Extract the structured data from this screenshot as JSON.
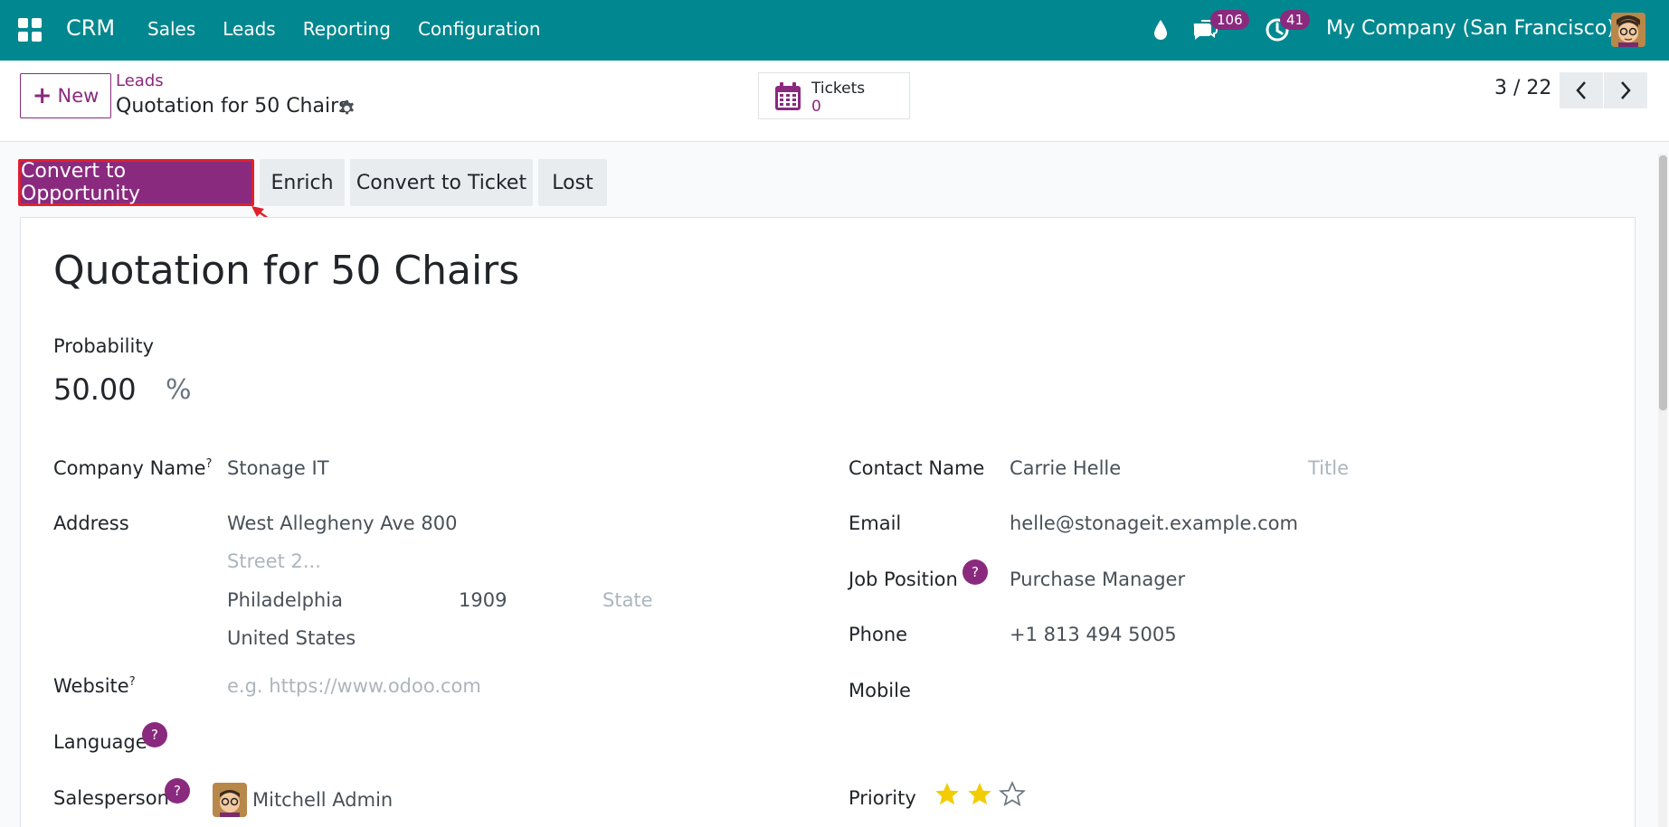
{
  "navbar": {
    "brand": "CRM",
    "menu": [
      "Sales",
      "Leads",
      "Reporting",
      "Configuration"
    ],
    "chat_count": "106",
    "activity_count": "41",
    "company": "My Company (San Francisco)"
  },
  "control_panel": {
    "new_label": "New",
    "breadcrumb_parent": "Leads",
    "breadcrumb_current": "Quotation for 50 Chairs",
    "smart_button": {
      "label": "Tickets",
      "value": "0"
    },
    "pager": "3 / 22"
  },
  "status_bar": {
    "convert_opportunity": "Convert to Opportunity",
    "enrich": "Enrich",
    "convert_ticket": "Convert to Ticket",
    "lost": "Lost"
  },
  "form": {
    "title": "Quotation for 50 Chairs",
    "probability_label": "Probability",
    "probability_value": "50.00",
    "probability_unit": "%",
    "left": {
      "company_name_label": "Company Name",
      "company_name": "Stonage IT",
      "address_label": "Address",
      "street": "West Allegheny Ave 800",
      "street2_placeholder": "Street 2...",
      "city": "Philadelphia",
      "zip": "1909",
      "state_placeholder": "State",
      "country": "United States",
      "website_label": "Website",
      "website_placeholder": "e.g. https://www.odoo.com",
      "language_label": "Language",
      "salesperson_label": "Salesperson",
      "salesperson": "Mitchell Admin"
    },
    "right": {
      "contact_name_label": "Contact Name",
      "contact_name": "Carrie Helle",
      "title_placeholder": "Title",
      "email_label": "Email",
      "email": "helle@stonageit.example.com",
      "job_position_label": "Job Position",
      "job_position": "Purchase Manager",
      "phone_label": "Phone",
      "phone": "+1 813 494 5005",
      "mobile_label": "Mobile",
      "priority_label": "Priority",
      "priority_stars": 2,
      "priority_max": 3
    },
    "help_mark": "?",
    "superscript_mark": "?"
  },
  "colors": {
    "navbar": "#00878f",
    "brand_purple": "#8a2a7e",
    "highlight_red": "#e0202e",
    "star_yellow": "#f3cc00"
  }
}
